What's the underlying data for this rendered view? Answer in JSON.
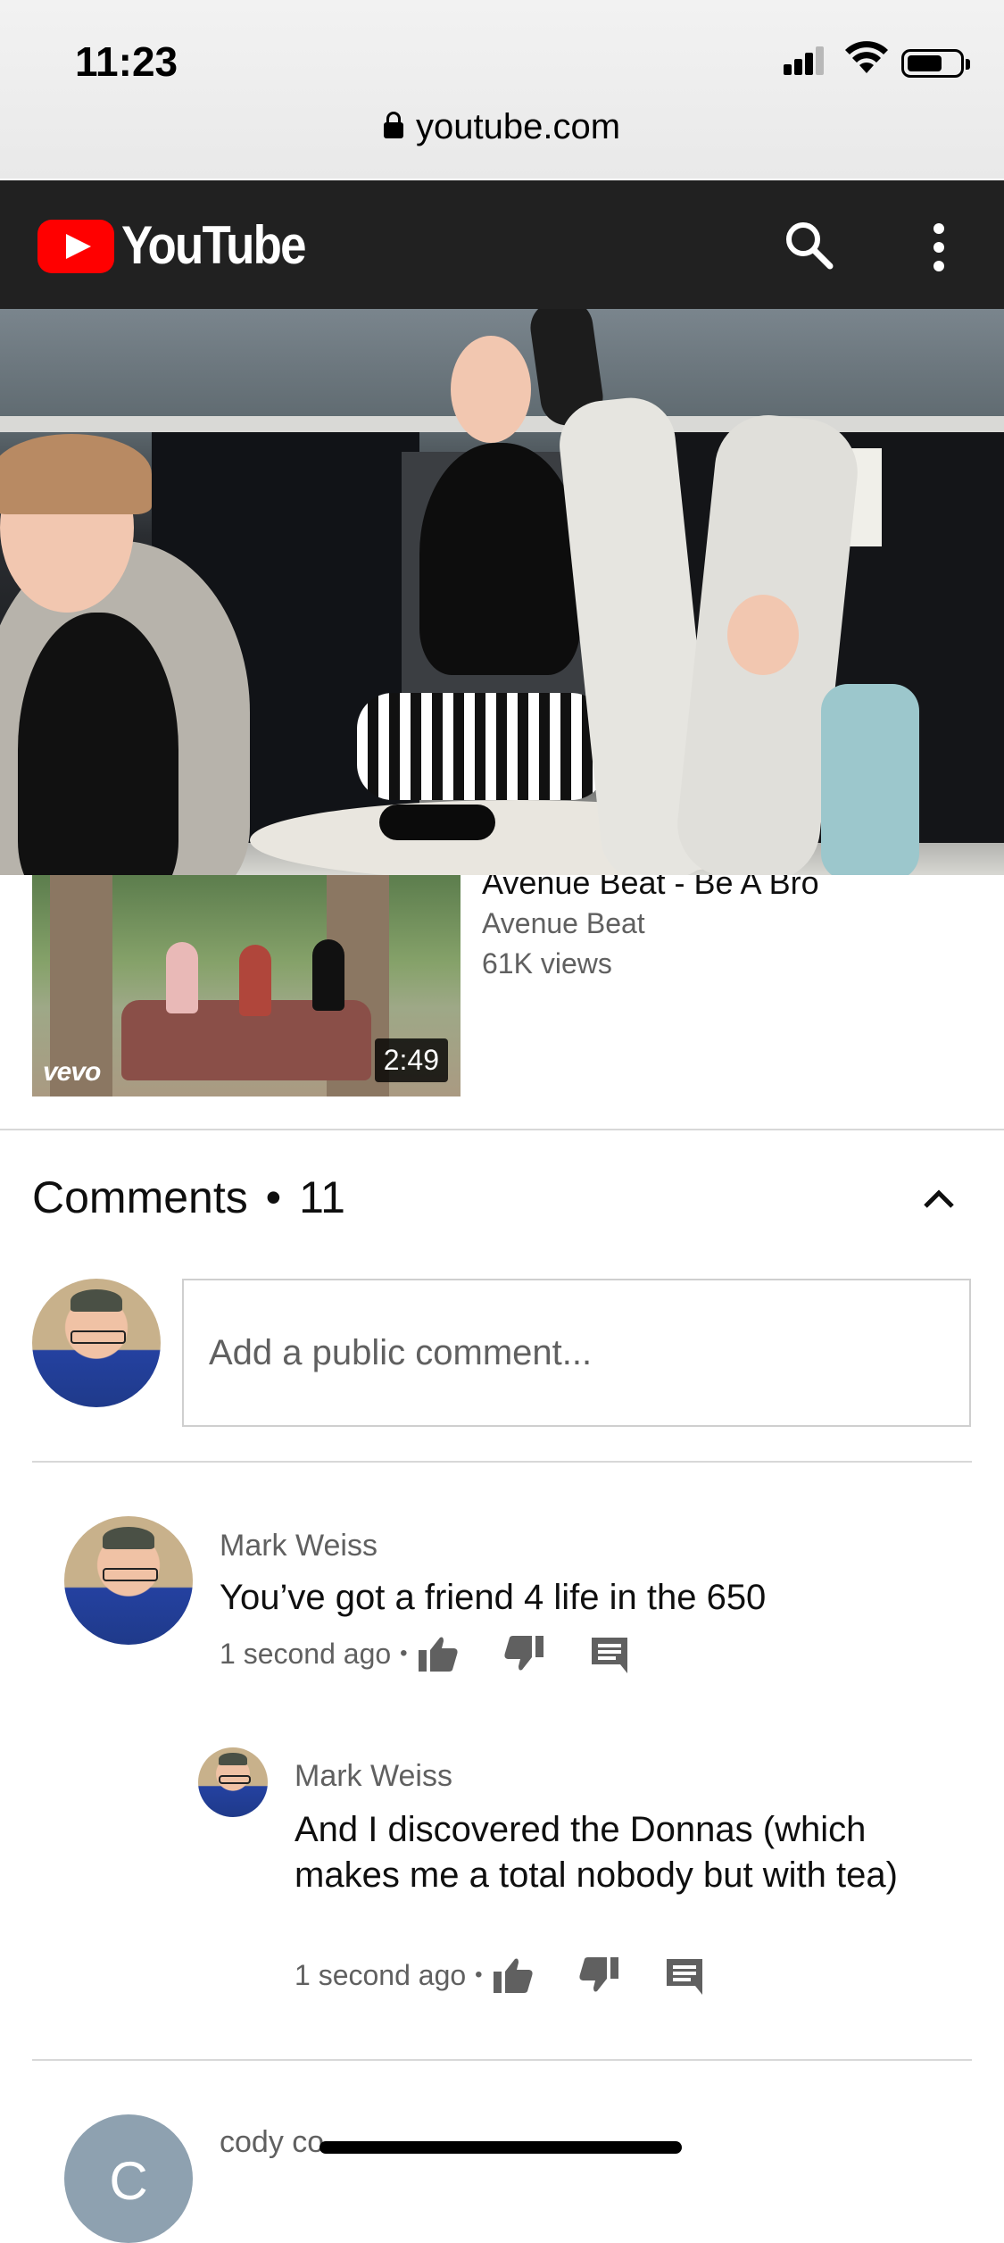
{
  "status_bar": {
    "time": "11:23",
    "url": "youtube.com"
  },
  "header": {
    "logo_text": "YouTube",
    "brand_color": "#ff0000",
    "background": "#212121"
  },
  "related_video": {
    "title": "Avenue Beat - Be A Bro",
    "channel": "Avenue Beat",
    "views": "61K views",
    "duration": "2:49",
    "watermark": "vevo"
  },
  "comments": {
    "title": "Comments",
    "separator": "•",
    "count": "11",
    "input_placeholder": "Add a public comment...",
    "items": [
      {
        "author": "Mark Weiss",
        "text": "You’ve got a friend 4 life in the 650",
        "time": "1 second ago"
      },
      {
        "author": "Mark Weiss",
        "text": "And I discovered the Donnas (which makes me a total nobody but with tea)",
        "time": "1 second ago"
      },
      {
        "author": "cody co",
        "avatar_letter": "C"
      }
    ]
  }
}
